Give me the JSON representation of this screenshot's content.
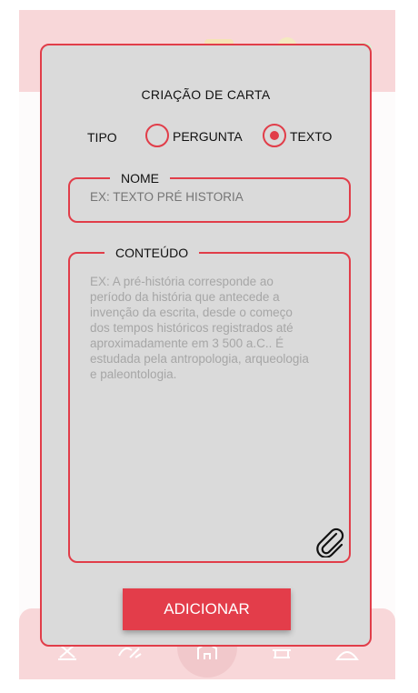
{
  "modal": {
    "title": "CRIAÇÃO DE CARTA",
    "type_label": "TIPO",
    "type_options": [
      {
        "label": "PERGUNTA",
        "selected": false
      },
      {
        "label": "TEXTO",
        "selected": true
      }
    ],
    "name_field": {
      "legend": "NOME",
      "placeholder": "EX: TEXTO PRÉ HISTORIA"
    },
    "content_field": {
      "legend": "CONTEÚDO",
      "placeholder": "EX: A pré-história corresponde ao\n período da história que antecede a\ninvenção da escrita, desde o começo\ndos tempos históricos registrados até\naproximadamente em 3 500 a.C.. É\n estudada pela antropologia, arqueologia\n e paleontologia.",
      "attach_icon": "paperclip-icon"
    },
    "submit_label": "ADICIONAR"
  },
  "colors": {
    "accent": "#e13d49",
    "modal_bg": "#dadada",
    "placeholder": "#a6a6a6"
  }
}
